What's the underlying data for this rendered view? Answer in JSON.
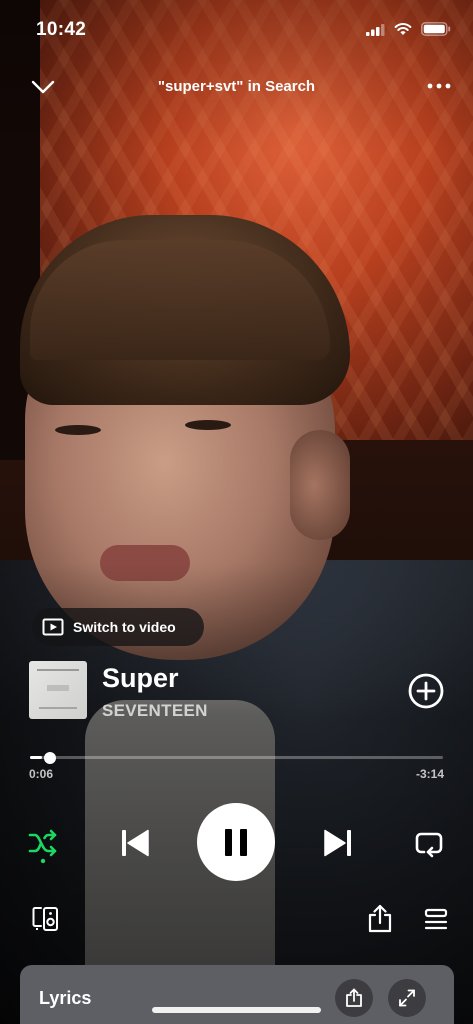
{
  "status_bar": {
    "time": "10:42"
  },
  "header": {
    "title": "\"super+svt\" in Search"
  },
  "video_toggle": {
    "label": "Switch to video"
  },
  "track": {
    "title": "Super",
    "artist": "SEVENTEEN"
  },
  "playback": {
    "elapsed": "0:06",
    "remaining": "-3:14",
    "progress": 0.03,
    "is_playing": true,
    "shuffle_on": true
  },
  "lyrics": {
    "label": "Lyrics"
  },
  "colors": {
    "accent": "#1ed760",
    "lyrics_card": "#5e5f64"
  },
  "icons": {
    "collapse": "chevron-down-icon",
    "more": "more-dots-icon",
    "video": "video-play-icon",
    "add": "add-circle-icon",
    "shuffle": "shuffle-icon",
    "previous": "skip-previous-icon",
    "pause": "pause-icon",
    "next": "skip-next-icon",
    "repeat": "repeat-icon",
    "devices": "connect-device-icon",
    "share": "share-icon",
    "queue": "queue-icon",
    "expand": "expand-icon"
  }
}
